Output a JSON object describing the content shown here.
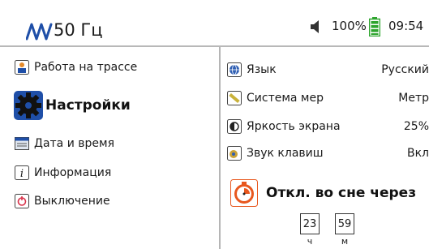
{
  "header": {
    "frequency": "50 Гц",
    "battery_percent": "100%",
    "clock": "09:54",
    "icons": [
      "sine-wave-icon",
      "speaker-icon",
      "battery-icon"
    ]
  },
  "menu": {
    "items": [
      {
        "label": "Работа на трассе",
        "icon": "route-work-icon"
      },
      {
        "label": "Настройки",
        "icon": "gear-icon",
        "active": true
      },
      {
        "label": "Дата и время",
        "icon": "calendar-icon"
      },
      {
        "label": "Информация",
        "icon": "info-icon"
      },
      {
        "label": "Выключение",
        "icon": "power-icon"
      }
    ]
  },
  "settings": {
    "rows": [
      {
        "label": "Язык",
        "value": "Русский",
        "icon": "globe-icon"
      },
      {
        "label": "Система мер",
        "value": "Метр",
        "icon": "ruler-icon"
      },
      {
        "label": "Яркость экрана",
        "value": "25%",
        "icon": "brightness-icon"
      },
      {
        "label": "Звук клавиш",
        "value": "Вкл",
        "icon": "key-sound-icon"
      }
    ],
    "sleep": {
      "title": "Откл. во сне через",
      "icon": "sleep-timer-icon",
      "hours": "23",
      "minutes": "59",
      "hours_unit": "ч",
      "minutes_unit": "м"
    }
  },
  "colors": {
    "accent_blue": "#1f4fa8",
    "battery_green": "#2ea52e",
    "timer_orange": "#e8571e",
    "divider": "#b5b5b5"
  }
}
